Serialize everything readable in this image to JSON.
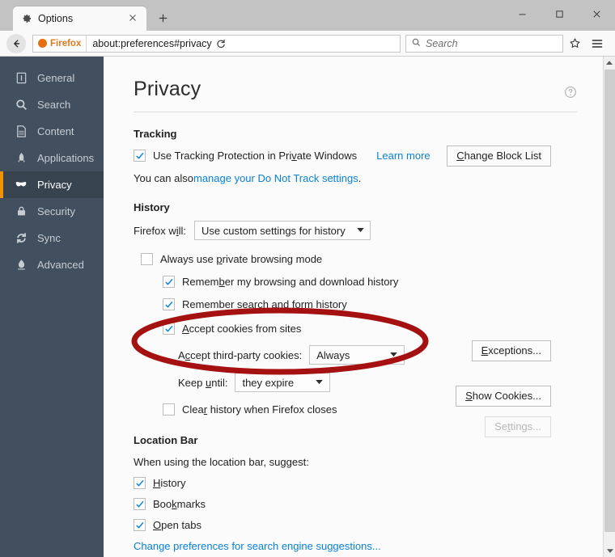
{
  "window": {
    "minimize_label": "Minimize",
    "maximize_label": "Maximize",
    "close_label": "Close"
  },
  "tabbar": {
    "tab_title": "Options",
    "tab_icon": "gear-icon",
    "close_icon": "close-icon",
    "newtab_label": "+"
  },
  "navbar": {
    "back_icon": "back-arrow-icon",
    "identity_label": "Firefox",
    "url": "about:preferences#privacy",
    "reload_icon": "reload-icon",
    "search_placeholder": "Search",
    "search_icon": "search-icon",
    "bookmark_icon": "star-icon",
    "menu_icon": "hamburger-menu-icon"
  },
  "sidebar": {
    "items": [
      {
        "label": "General",
        "icon": "general-icon",
        "selected": false
      },
      {
        "label": "Search",
        "icon": "search-icon",
        "selected": false
      },
      {
        "label": "Content",
        "icon": "content-icon",
        "selected": false
      },
      {
        "label": "Applications",
        "icon": "applications-icon",
        "selected": false
      },
      {
        "label": "Privacy",
        "icon": "mask-icon",
        "selected": true
      },
      {
        "label": "Security",
        "icon": "lock-icon",
        "selected": false
      },
      {
        "label": "Sync",
        "icon": "sync-icon",
        "selected": false
      },
      {
        "label": "Advanced",
        "icon": "advanced-icon",
        "selected": false
      }
    ],
    "accent_color": "#f09300",
    "background_color": "#424f5e",
    "selected_background": "#37434f"
  },
  "main": {
    "title": "Privacy",
    "help_icon": "help-circle-icon",
    "tracking": {
      "heading": "Tracking",
      "checkbox_label": "Use Tracking Protection in Private Windows",
      "checkbox_checked": true,
      "learn_more": "Learn more",
      "note_prefix": "You can also ",
      "note_link": "manage your Do Not Track settings",
      "note_suffix": ".",
      "change_block_list": "Change Block List"
    },
    "history": {
      "heading": "History",
      "firefox_will_label": "Firefox will:",
      "mode_value": "Use custom settings for history",
      "always_private_label": "Always use private browsing mode",
      "always_private_checked": false,
      "remember_browsing_label": "Remember my browsing and download history",
      "remember_browsing_checked": true,
      "remember_search_label": "Remember search and form history",
      "remember_search_checked": true,
      "accept_cookies_label": "Accept cookies from sites",
      "accept_cookies_checked": true,
      "third_party_label": "Accept third-party cookies:",
      "third_party_value": "Always",
      "keep_until_label": "Keep until:",
      "keep_until_value": "they expire",
      "clear_on_close_label": "Clear history when Firefox closes",
      "clear_on_close_checked": false,
      "exceptions_button": "Exceptions...",
      "show_cookies_button": "Show Cookies...",
      "settings_button": "Settings...",
      "settings_disabled": true
    },
    "location_bar": {
      "heading": "Location Bar",
      "subtitle": "When using the location bar, suggest:",
      "items": [
        {
          "label": "History",
          "checked": true
        },
        {
          "label": "Bookmarks",
          "checked": true
        },
        {
          "label": "Open tabs",
          "checked": true
        }
      ],
      "change_prefs_link": "Change preferences for search engine suggestions..."
    }
  },
  "annotation": {
    "shape": "ellipse",
    "color": "#a51111",
    "targets": [
      "Accept cookies from sites",
      "Accept third-party cookies: Always"
    ]
  },
  "scrollbar": {
    "up_icon": "chevron-up-icon",
    "down_icon": "chevron-down-icon"
  }
}
